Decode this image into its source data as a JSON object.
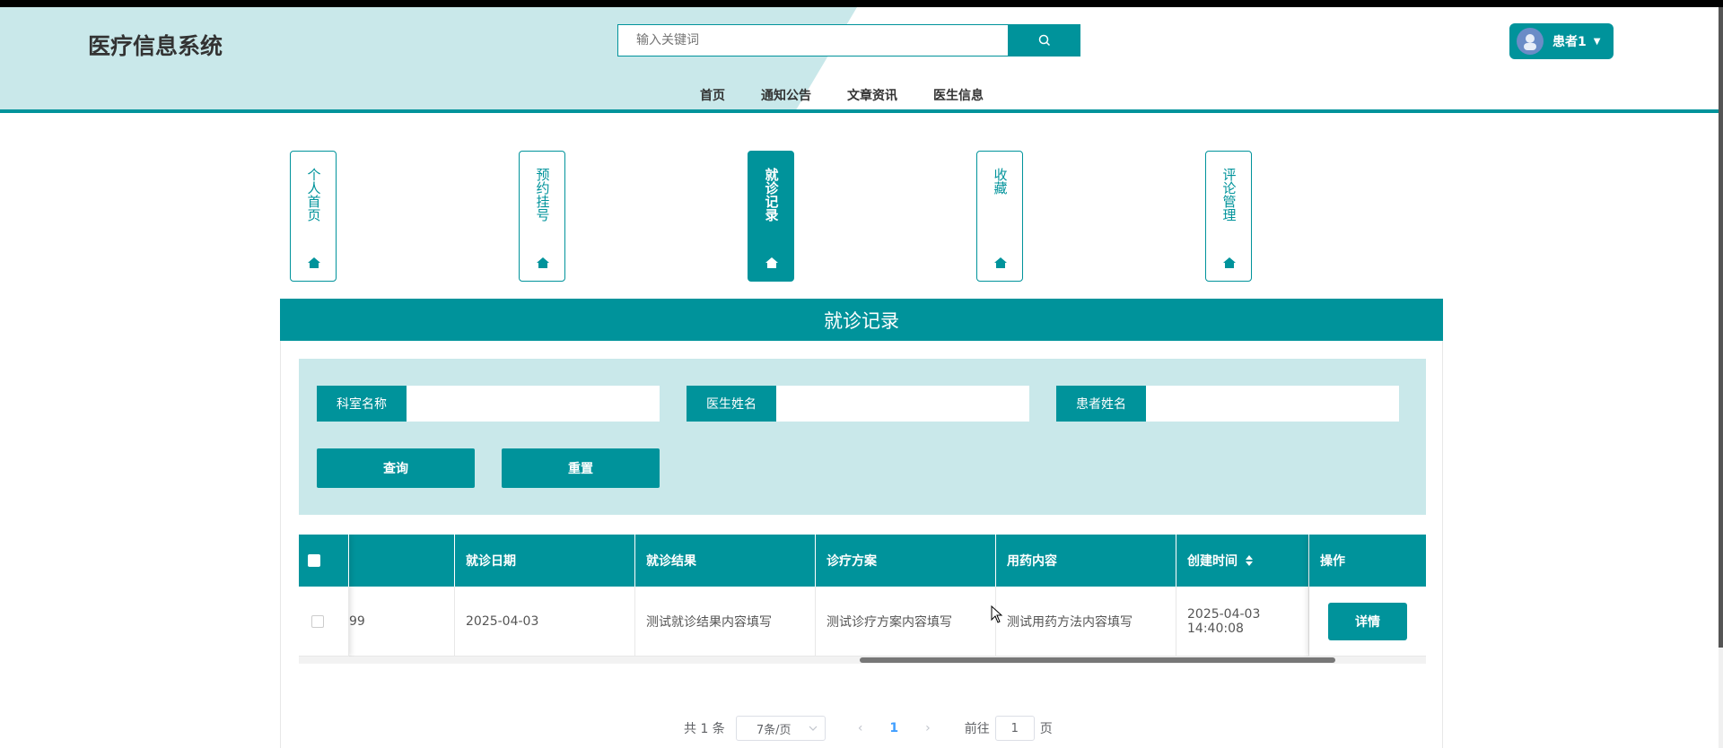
{
  "header": {
    "logo": "医疗信息系统",
    "search_placeholder": "输入关键词",
    "nav": [
      "首页",
      "通知公告",
      "文章资讯",
      "医生信息"
    ],
    "user_name": "患者1"
  },
  "tabs": [
    {
      "label": "个人首页",
      "active": false
    },
    {
      "label": "预约挂号",
      "active": false
    },
    {
      "label": "就诊记录",
      "active": true
    },
    {
      "label": "收藏",
      "active": false
    },
    {
      "label": "评论管理",
      "active": false
    }
  ],
  "panel": {
    "title": "就诊记录",
    "filters": [
      {
        "label": "科室名称",
        "value": ""
      },
      {
        "label": "医生姓名",
        "value": ""
      },
      {
        "label": "患者姓名",
        "value": ""
      }
    ],
    "query_button": "查询",
    "reset_button": "重置"
  },
  "table": {
    "columns": [
      "",
      "就诊日期",
      "就诊结果",
      "诊疗方案",
      "用药内容",
      "创建时间",
      "操作"
    ],
    "rows": [
      {
        "partial_cell": "99",
        "date": "2025-04-03",
        "result": "测试就诊结果内容填写",
        "plan": "测试诊疗方案内容填写",
        "medication": "测试用药方法内容填写",
        "created": "2025-04-03 14:40:08",
        "action": "详情"
      }
    ]
  },
  "pagination": {
    "total": "共 1 条",
    "page_size": "7条/页",
    "current_page": "1",
    "goto_label": "前往",
    "goto_value": "1",
    "page_suffix": "页"
  },
  "colors": {
    "primary": "#00939b",
    "light": "#c9e8ea"
  }
}
